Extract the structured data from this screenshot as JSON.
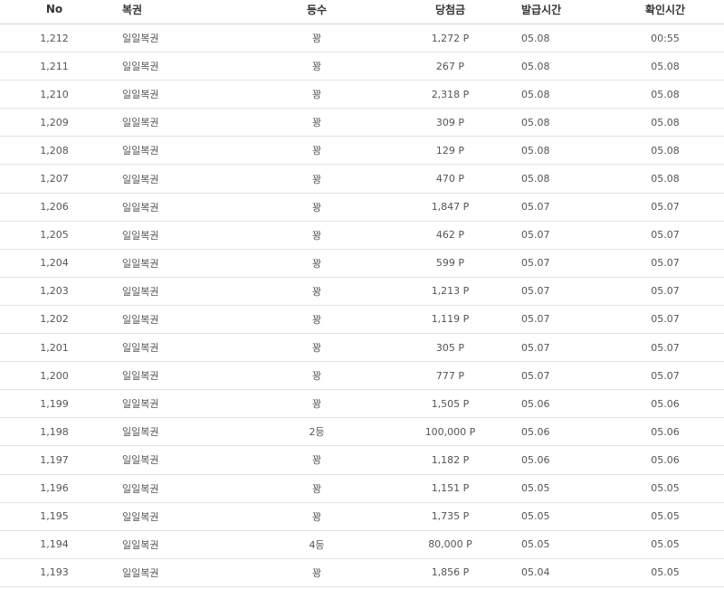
{
  "table": {
    "headers": {
      "no": "No",
      "ticket": "복권",
      "rank": "등수",
      "amount": "당첨금",
      "issued": "발급시간",
      "checked": "확인시간"
    },
    "rows": [
      {
        "no": "1,212",
        "ticket": "일일복권",
        "rank": "꽝",
        "amount": "1,272 P",
        "issued": "05.08",
        "checked": "00:55"
      },
      {
        "no": "1,211",
        "ticket": "일일복권",
        "rank": "꽝",
        "amount": "267 P",
        "issued": "05.08",
        "checked": "05.08"
      },
      {
        "no": "1,210",
        "ticket": "일일복권",
        "rank": "꽝",
        "amount": "2,318 P",
        "issued": "05.08",
        "checked": "05.08"
      },
      {
        "no": "1,209",
        "ticket": "일일복권",
        "rank": "꽝",
        "amount": "309 P",
        "issued": "05.08",
        "checked": "05.08"
      },
      {
        "no": "1,208",
        "ticket": "일일복권",
        "rank": "꽝",
        "amount": "129 P",
        "issued": "05.08",
        "checked": "05.08"
      },
      {
        "no": "1,207",
        "ticket": "일일복권",
        "rank": "꽝",
        "amount": "470 P",
        "issued": "05.08",
        "checked": "05.08"
      },
      {
        "no": "1,206",
        "ticket": "일일복권",
        "rank": "꽝",
        "amount": "1,847 P",
        "issued": "05.07",
        "checked": "05.07"
      },
      {
        "no": "1,205",
        "ticket": "일일복권",
        "rank": "꽝",
        "amount": "462 P",
        "issued": "05.07",
        "checked": "05.07"
      },
      {
        "no": "1,204",
        "ticket": "일일복권",
        "rank": "꽝",
        "amount": "599 P",
        "issued": "05.07",
        "checked": "05.07"
      },
      {
        "no": "1,203",
        "ticket": "일일복권",
        "rank": "꽝",
        "amount": "1,213 P",
        "issued": "05.07",
        "checked": "05.07"
      },
      {
        "no": "1,202",
        "ticket": "일일복권",
        "rank": "꽝",
        "amount": "1,119 P",
        "issued": "05.07",
        "checked": "05.07"
      },
      {
        "no": "1,201",
        "ticket": "일일복권",
        "rank": "꽝",
        "amount": "305 P",
        "issued": "05.07",
        "checked": "05.07"
      },
      {
        "no": "1,200",
        "ticket": "일일복권",
        "rank": "꽝",
        "amount": "777 P",
        "issued": "05.07",
        "checked": "05.07"
      },
      {
        "no": "1,199",
        "ticket": "일일복권",
        "rank": "꽝",
        "amount": "1,505 P",
        "issued": "05.06",
        "checked": "05.06"
      },
      {
        "no": "1,198",
        "ticket": "일일복권",
        "rank": "2등",
        "amount": "100,000 P",
        "issued": "05.06",
        "checked": "05.06"
      },
      {
        "no": "1,197",
        "ticket": "일일복권",
        "rank": "꽝",
        "amount": "1,182 P",
        "issued": "05.06",
        "checked": "05.06"
      },
      {
        "no": "1,196",
        "ticket": "일일복권",
        "rank": "꽝",
        "amount": "1,151 P",
        "issued": "05.05",
        "checked": "05.05"
      },
      {
        "no": "1,195",
        "ticket": "일일복권",
        "rank": "꽝",
        "amount": "1,735 P",
        "issued": "05.05",
        "checked": "05.05"
      },
      {
        "no": "1,194",
        "ticket": "일일복권",
        "rank": "4등",
        "amount": "80,000 P",
        "issued": "05.05",
        "checked": "05.05"
      },
      {
        "no": "1,193",
        "ticket": "일일복권",
        "rank": "꽝",
        "amount": "1,856 P",
        "issued": "05.04",
        "checked": "05.05"
      }
    ]
  }
}
